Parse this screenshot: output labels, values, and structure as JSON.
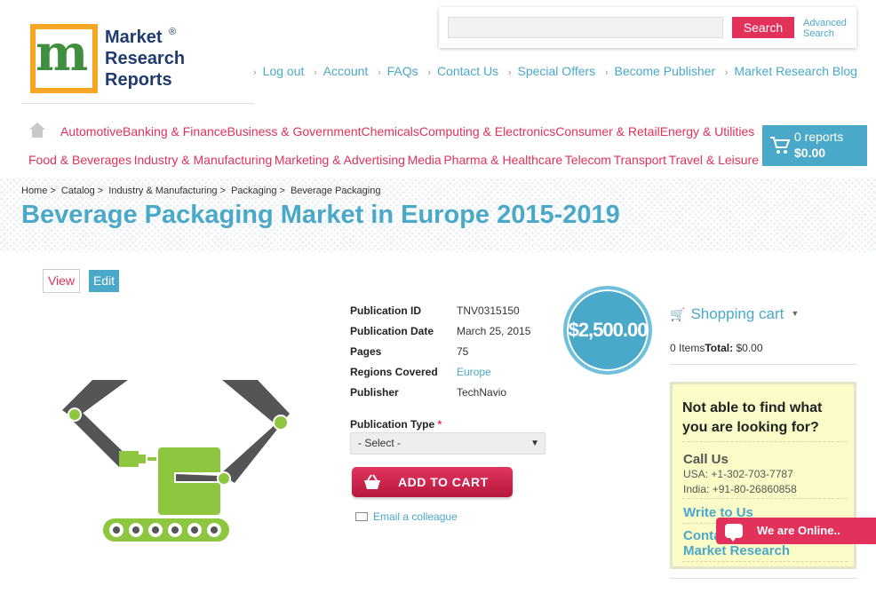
{
  "logo": {
    "line1": "Market",
    "line2": "Research",
    "line3": "Reports",
    "registered": "®"
  },
  "search": {
    "placeholder": "",
    "button": "Search",
    "advanced_line1": "Advanced",
    "advanced_line2": "Search"
  },
  "top_links": [
    "Log out",
    "Account",
    "FAQs",
    "Contact Us",
    "Special Offers",
    "Become Publisher",
    "Market Research Blog"
  ],
  "categories_row1": [
    "Automotive",
    "Banking & Finance",
    "Business & Government",
    "Chemicals",
    "Computing & Electronics",
    "Consumer & Retail",
    "Energy & Utilities"
  ],
  "categories_row2": [
    "Food & Beverages",
    "Industry & Manufacturing",
    "Marketing & Advertising",
    "Media",
    "Pharma & Healthcare",
    "Telecom",
    "Transport",
    "Travel & Leisure"
  ],
  "cart_top": {
    "reports": "0 reports",
    "total": "$0.00"
  },
  "breadcrumb": [
    "Home",
    "Catalog",
    "Industry & Manufacturing",
    "Packaging",
    "Beverage Packaging"
  ],
  "page_title": "Beverage Packaging Market in Europe 2015-2019",
  "tabs": {
    "view": "View",
    "edit": "Edit"
  },
  "details": [
    {
      "label": "Publication ID",
      "value": "TNV0315150"
    },
    {
      "label": "Publication Date",
      "value": "March 25, 2015"
    },
    {
      "label": "Pages",
      "value": "75"
    },
    {
      "label": "Regions Covered",
      "value": "Europe"
    },
    {
      "label": "Publisher",
      "value": "TechNavio"
    }
  ],
  "publication_type": {
    "label": "Publication Type",
    "required": "*",
    "selected": "- Select -"
  },
  "add_to_cart": "ADD TO CART",
  "email_colleague": "Email a colleague",
  "price": "$2,500.00",
  "shopping_cart": {
    "title": "Shopping cart",
    "items": "0 Items",
    "total_label": "Total:",
    "total_value": "$0.00"
  },
  "help_box": {
    "heading": "Not able to find what you are looking for?",
    "call_us": "Call Us",
    "phone_usa": "USA: +1-302-703-7787",
    "phone_india": "India: +91-80-26860858",
    "write_to_us": "Write to Us",
    "contact_line1": "Conta",
    "contact_line2": "Market Research"
  },
  "chat": {
    "label": "We are Online.."
  },
  "colors": {
    "accent_pink": "#e2315a",
    "accent_blue": "#4aa8c8",
    "logo_orange": "#f6a623"
  }
}
